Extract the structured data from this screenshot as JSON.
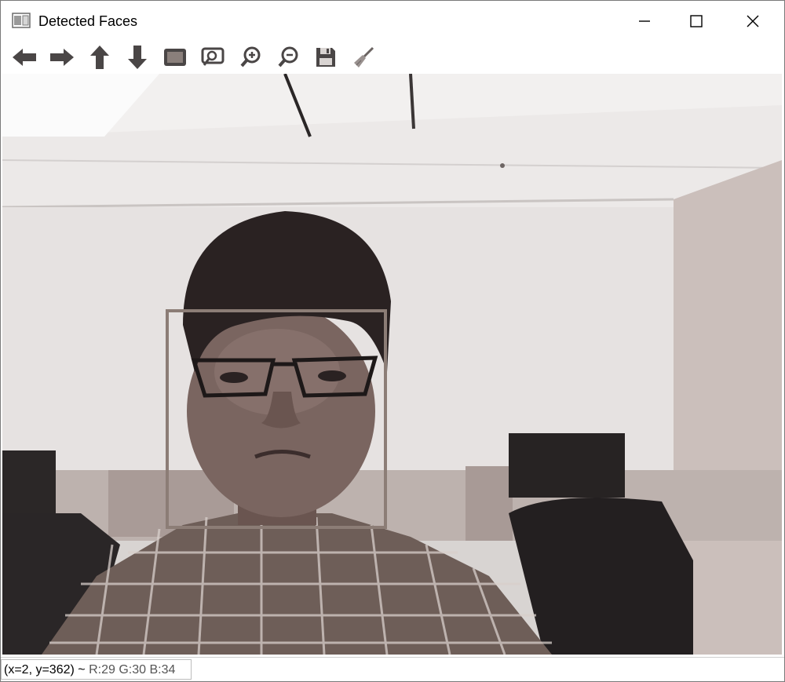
{
  "window": {
    "title": "Detected Faces"
  },
  "toolbar": {
    "buttons": [
      {
        "name": "pan-left",
        "icon": "arrow-left-icon"
      },
      {
        "name": "pan-right",
        "icon": "arrow-right-icon"
      },
      {
        "name": "pan-up",
        "icon": "arrow-up-icon"
      },
      {
        "name": "pan-down",
        "icon": "arrow-down-icon"
      },
      {
        "name": "zoom-fit",
        "icon": "image-fit-icon"
      },
      {
        "name": "zoom-original",
        "icon": "zoom-region-icon"
      },
      {
        "name": "zoom-in",
        "icon": "zoom-in-icon"
      },
      {
        "name": "zoom-out",
        "icon": "zoom-out-icon"
      },
      {
        "name": "save",
        "icon": "save-icon"
      },
      {
        "name": "properties",
        "icon": "brush-icon"
      }
    ]
  },
  "status": {
    "coords": "(x=2, y=362) ~",
    "rgb": "R:29 G:30 B:34"
  },
  "colors": {
    "detection_box": "#8c7d76",
    "toolbar_icon": "#4a4646"
  }
}
